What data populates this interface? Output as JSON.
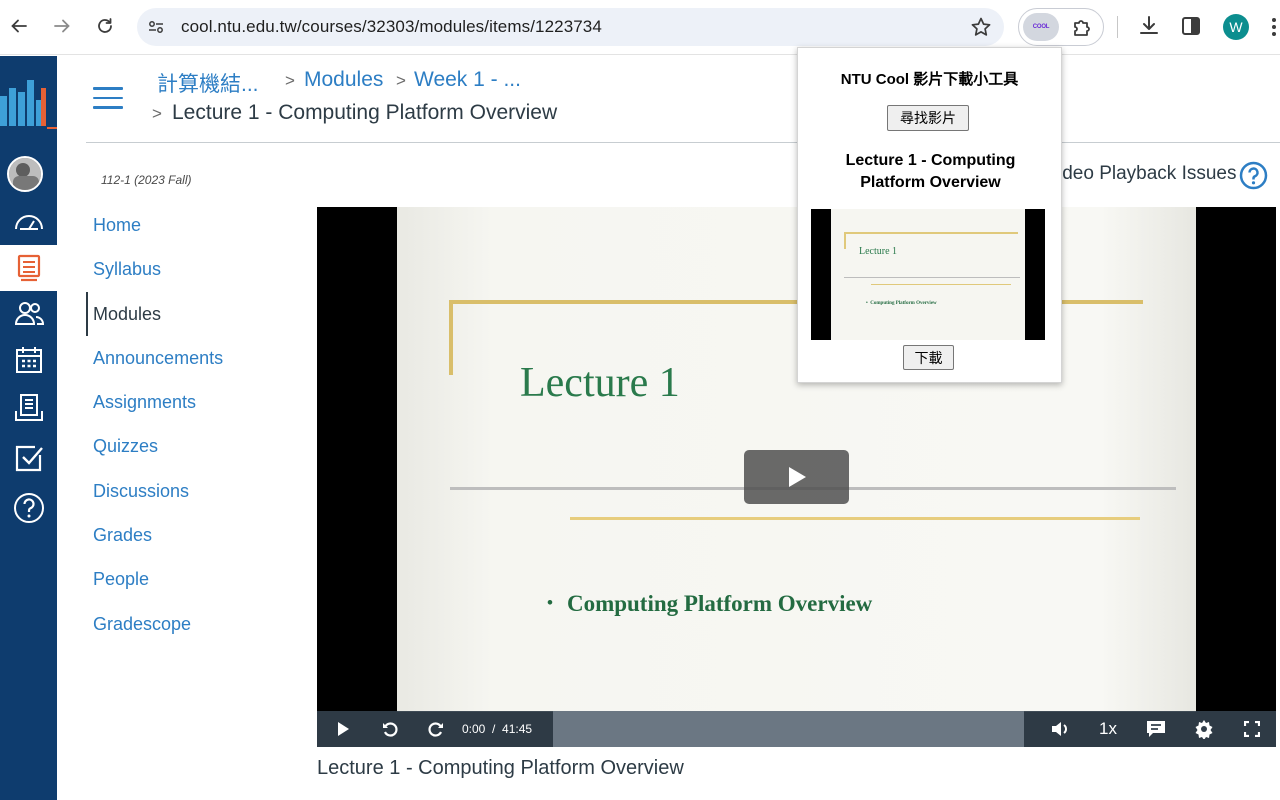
{
  "browser": {
    "url": "cool.ntu.edu.tw/courses/32303/modules/items/1223734",
    "profile_initial": "W",
    "extension_badge": "COOL"
  },
  "breadcrumb": {
    "course": "計算機結...",
    "modules": "Modules",
    "week": "Week 1 - ...",
    "current": "Lecture 1 - Computing Platform Overview"
  },
  "course_nav": {
    "term": "112-1 (2023 Fall)",
    "items": [
      {
        "label": "Home",
        "active": false
      },
      {
        "label": "Syllabus",
        "active": false
      },
      {
        "label": "Modules",
        "active": true
      },
      {
        "label": "Announcements",
        "active": false
      },
      {
        "label": "Assignments",
        "active": false
      },
      {
        "label": "Quizzes",
        "active": false
      },
      {
        "label": "Discussions",
        "active": false
      },
      {
        "label": "Grades",
        "active": false
      },
      {
        "label": "People",
        "active": false
      },
      {
        "label": "Gradescope",
        "active": false
      }
    ]
  },
  "video": {
    "help_text": "ideo Playback Issues",
    "slide_title": "Lecture 1",
    "slide_bullet": "Computing Platform Overview",
    "current_time": "0:00",
    "duration": "41:45",
    "speed": "1x",
    "caption": "Lecture 1 - Computing Platform Overview"
  },
  "popup": {
    "title": "NTU Cool 影片下載小工具",
    "find_button": "尋找影片",
    "video_title": "Lecture 1 - Computing Platform Overview",
    "thumb_title": "Lecture 1",
    "thumb_bullet": "Computing Platform Overview",
    "download_button": "下載"
  },
  "colors": {
    "canvas_nav": "#0e3c6e",
    "link": "#2d7ec4",
    "active_nav_icon": "#e66135",
    "slide_green": "#2a7a4c",
    "slide_gold": "#d9be6a"
  }
}
